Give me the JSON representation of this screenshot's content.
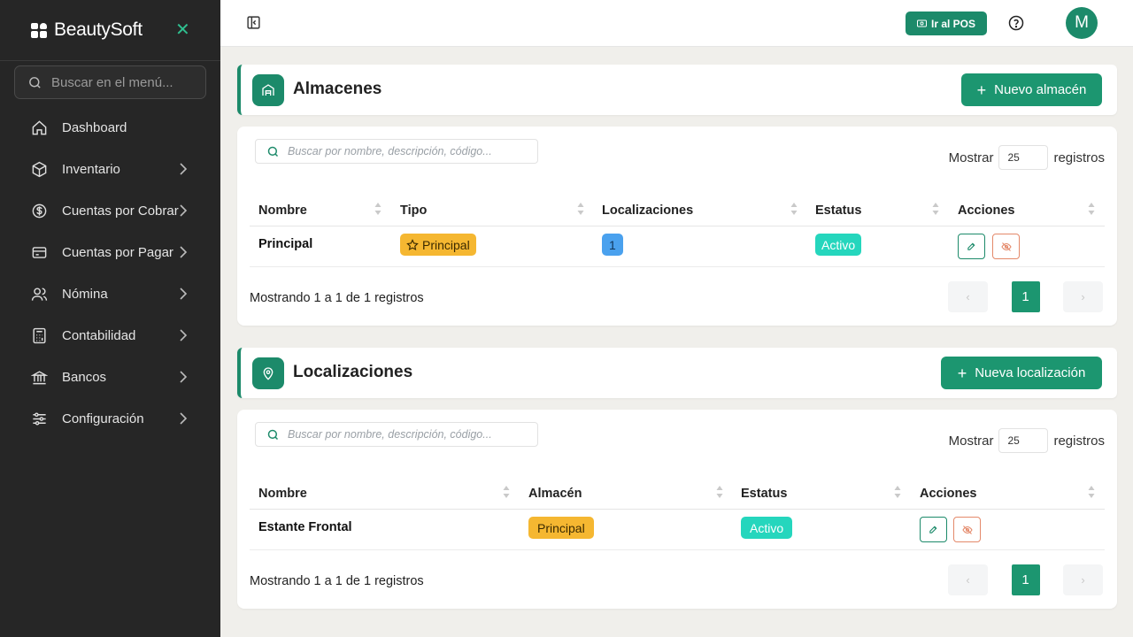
{
  "sidebar": {
    "brand": "BeautySoft",
    "search_placeholder": "Buscar en el menú...",
    "items": [
      {
        "label": "Dashboard",
        "icon": "home-icon"
      },
      {
        "label": "Inventario",
        "icon": "box-icon"
      },
      {
        "label": "Cuentas por Cobrar",
        "icon": "dollar-circle-icon"
      },
      {
        "label": "Cuentas por Pagar",
        "icon": "credit-card-icon"
      },
      {
        "label": "Nómina",
        "icon": "users-icon"
      },
      {
        "label": "Contabilidad",
        "icon": "calculator-icon"
      },
      {
        "label": "Bancos",
        "icon": "bank-icon"
      },
      {
        "label": "Configuración",
        "icon": "sliders-icon"
      }
    ]
  },
  "topbar": {
    "pos_label": "Ir al POS",
    "avatar_initial": "M"
  },
  "almacenes": {
    "title": "Almacenes",
    "add_label": "Nuevo almacén",
    "search_placeholder": "Buscar por nombre, descripción, código...",
    "show_prefix": "Mostrar",
    "show_value": "25",
    "show_suffix": "registros",
    "columns": [
      "Nombre",
      "Tipo",
      "Localizaciones",
      "Estatus",
      "Acciones"
    ],
    "rows": [
      {
        "nombre": "Principal",
        "tipo": "Principal",
        "localizaciones": "1",
        "estatus": "Activo"
      }
    ],
    "info": "Mostrando 1 a 1 de 1 registros",
    "prev": "‹",
    "page": "1",
    "next": "›"
  },
  "localizaciones": {
    "title": "Localizaciones",
    "add_label": "Nueva localización",
    "search_placeholder": "Buscar por nombre, descripción, código...",
    "show_prefix": "Mostrar",
    "show_value": "25",
    "show_suffix": "registros",
    "columns": [
      "Nombre",
      "Almacén",
      "Estatus",
      "Acciones"
    ],
    "rows": [
      {
        "nombre": "Estante Frontal",
        "almacen": "Principal",
        "estatus": "Activo"
      }
    ],
    "info": "Mostrando 1 a 1 de 1 registros",
    "prev": "‹",
    "page": "1",
    "next": "›"
  },
  "colors": {
    "accent": "#1c8a6a",
    "sidebar_bg": "#262626",
    "badge_yellow": "#f5b731",
    "badge_blue": "#4aa1ee",
    "badge_teal": "#25d6bd"
  }
}
